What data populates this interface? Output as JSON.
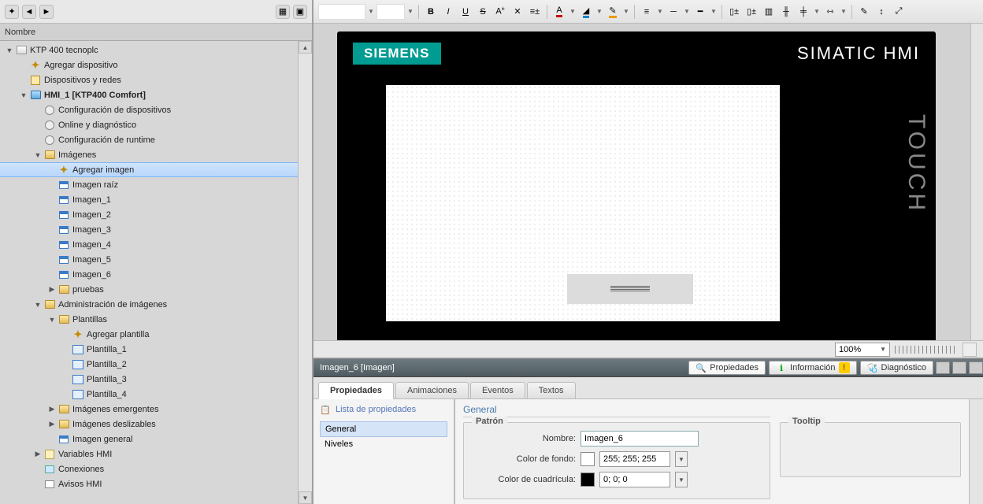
{
  "left": {
    "header": "Nombre",
    "tree": [
      {
        "d": 0,
        "tw": "down",
        "ic": "project",
        "label": "KTP 400 tecnoplc"
      },
      {
        "d": 1,
        "tw": "",
        "ic": "add",
        "label": "Agregar dispositivo"
      },
      {
        "d": 1,
        "tw": "",
        "ic": "net",
        "label": "Dispositivos y redes"
      },
      {
        "d": 1,
        "tw": "down",
        "ic": "hmi",
        "label": "HMI_1 [KTP400 Comfort]",
        "bold": true
      },
      {
        "d": 2,
        "tw": "",
        "ic": "gear",
        "label": "Configuración de dispositivos"
      },
      {
        "d": 2,
        "tw": "",
        "ic": "gear",
        "label": "Online y diagnóstico"
      },
      {
        "d": 2,
        "tw": "",
        "ic": "gear",
        "label": "Configuración de runtime"
      },
      {
        "d": 2,
        "tw": "down",
        "ic": "folder",
        "label": "Imágenes"
      },
      {
        "d": 3,
        "tw": "",
        "ic": "add",
        "label": "Agregar imagen",
        "sel": true
      },
      {
        "d": 3,
        "tw": "",
        "ic": "screen",
        "label": "Imagen raíz"
      },
      {
        "d": 3,
        "tw": "",
        "ic": "screen",
        "label": "Imagen_1"
      },
      {
        "d": 3,
        "tw": "",
        "ic": "screen",
        "label": "Imagen_2"
      },
      {
        "d": 3,
        "tw": "",
        "ic": "screen",
        "label": "Imagen_3"
      },
      {
        "d": 3,
        "tw": "",
        "ic": "screen",
        "label": "Imagen_4"
      },
      {
        "d": 3,
        "tw": "",
        "ic": "screen",
        "label": "Imagen_5"
      },
      {
        "d": 3,
        "tw": "",
        "ic": "screen",
        "label": "Imagen_6"
      },
      {
        "d": 3,
        "tw": "right",
        "ic": "folder",
        "label": "pruebas"
      },
      {
        "d": 2,
        "tw": "down",
        "ic": "folder",
        "label": "Administración de imágenes"
      },
      {
        "d": 3,
        "tw": "down",
        "ic": "folder",
        "label": "Plantillas"
      },
      {
        "d": 4,
        "tw": "",
        "ic": "add",
        "label": "Agregar plantilla"
      },
      {
        "d": 4,
        "tw": "",
        "ic": "template",
        "label": "Plantilla_1"
      },
      {
        "d": 4,
        "tw": "",
        "ic": "template",
        "label": "Plantilla_2"
      },
      {
        "d": 4,
        "tw": "",
        "ic": "template",
        "label": "Plantilla_3"
      },
      {
        "d": 4,
        "tw": "",
        "ic": "template",
        "label": "Plantilla_4"
      },
      {
        "d": 3,
        "tw": "right",
        "ic": "folder",
        "label": "Imágenes emergentes"
      },
      {
        "d": 3,
        "tw": "right",
        "ic": "folder",
        "label": "Imágenes deslizables"
      },
      {
        "d": 3,
        "tw": "",
        "ic": "screen",
        "label": "Imagen general"
      },
      {
        "d": 2,
        "tw": "right",
        "ic": "var",
        "label": "Variables HMI"
      },
      {
        "d": 2,
        "tw": "",
        "ic": "link",
        "label": "Conexiones"
      },
      {
        "d": 2,
        "tw": "",
        "ic": "msg",
        "label": "Avisos HMI"
      }
    ]
  },
  "editor_toolbar": {
    "bold": "B",
    "italic": "I",
    "underline": "U",
    "strike": "S",
    "sup": "A",
    "xmark": "✕"
  },
  "device": {
    "brand": "SIEMENS",
    "product": "SIMATIC HMI",
    "side": "TOUCH"
  },
  "zoom": {
    "value": "100%"
  },
  "props": {
    "bar_title": "Imagen_6 [Imagen]",
    "pills": [
      "Propiedades",
      "Información",
      "Diagnóstico"
    ],
    "tabs": [
      "Propiedades",
      "Animaciones",
      "Eventos",
      "Textos"
    ],
    "list_head": "Lista de propiedades",
    "list": [
      "General",
      "Niveles"
    ],
    "section": "General",
    "patron": "Patrón",
    "tooltip": "Tooltip",
    "name_lbl": "Nombre:",
    "name_val": "Imagen_6",
    "bg_lbl": "Color de fondo:",
    "bg_val": "255; 255; 255",
    "grid_lbl": "Color de cuadrícula:",
    "grid_val": "0; 0; 0"
  }
}
